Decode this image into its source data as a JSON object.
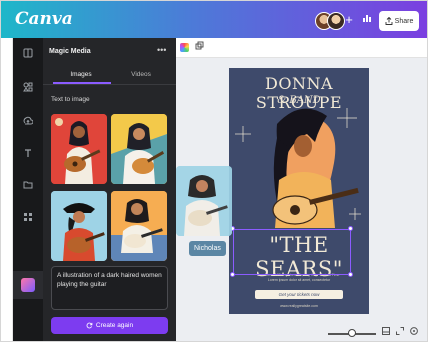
{
  "app": {
    "logo_text": "Canva",
    "share_label": "Share",
    "share_icon": "upload-icon",
    "stats_icon": "bar-chart-icon"
  },
  "rail": {
    "icons": [
      "template-icon",
      "elements-icon",
      "uploads-icon",
      "text-icon",
      "projects-icon",
      "apps-icon",
      "magic-media-icon"
    ]
  },
  "panel": {
    "title": "Magic Media",
    "more_label": "•••",
    "tabs": [
      {
        "label": "Images",
        "active": true
      },
      {
        "label": "Videos",
        "active": false
      }
    ],
    "section_label": "Text to image",
    "prompt_text": "A illustration of a dark haired women playing the guitar",
    "create_button_label": "Create again"
  },
  "canvas": {
    "poster": {
      "title": "DONNA STROUPE",
      "subtitle": "& BAND",
      "headline": "\"THE SEARS\"",
      "details_line1": "Location · 123 Anywhere St., Any City · Date & Time",
      "details_line2": "Lorem ipsum dolor sit amet, consectetur",
      "tickets_label": "Get your tickets now",
      "url": "www.reallygreatsite.com"
    },
    "drag_label": "Nicholas"
  },
  "colors": {
    "accent": "#7d3cf0",
    "panel_bg": "#252629",
    "poster_bg": "#3e4a6b"
  }
}
